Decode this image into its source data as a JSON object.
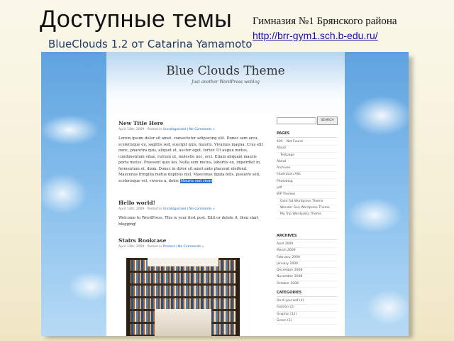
{
  "slide": {
    "title": "Доступные темы",
    "subtitle": "BlueClouds 1.2 от Catarina Yamamoto",
    "school": "Гимназия №1 Брянского района",
    "url": "http://brr-gym1.sch.b-edu.ru/"
  },
  "blog": {
    "title": "Blue Clouds Theme",
    "tagline": "Just another WordPress weblog"
  },
  "posts": [
    {
      "title": "New Title Here",
      "date": "April 13th, 2009",
      "posted_in": "· Posted in",
      "category": "Uncategorized",
      "comments": "| No Comments »",
      "body": "Lorem ipsum dolor sit amet, consectetur adipiscing elit. Donec sem arcu, scelerisque eu, sagittis sed, suscipit quis, mauris. Vivamus magna. Cras elit nunc, pharetra quis, aliquet et, auctor eget, tortor. Ut augue metus, condimentum vitae, rutrum ut, molestie nec, orci. Etiam aliquam mauris porta metus. Praesent quis leo. Nulla sem metus, lobortis eu, imperdiet in, fermentum et, diam. Donec in dolor sit amet ante placerat eleifend. Maecenas fringilla metus dapibus nisl. Maecenas ligula felis, posuere sed, scelerisque vel, viverra a, dolor.",
      "highlight": "Mauris sed risus",
      "tail": "."
    },
    {
      "title": "Hello world!",
      "date": "April 13th, 2009",
      "posted_in": "· Posted in",
      "category": "Uncategorized",
      "comments": "| No Comments »",
      "body": "Welcome to WordPress. This is your first post. Edit or delete it, then start blogging!"
    },
    {
      "title": "Stairs Bookcase",
      "date": "April 13th, 2009",
      "posted_in": "· Posted in",
      "category": "Product",
      "comments": "| No Comments »"
    }
  ],
  "sidebar": {
    "search_button": "SEARCH",
    "pages_title": "PAGES",
    "pages": [
      "404 – Not Found",
      "About",
      "Testpage",
      "About",
      "Archives",
      "Illustration Alts",
      "Photoblog",
      "pdf",
      "WP Themes",
      "Gold Fat Wordpress Theme",
      "Wonder Gen Wordpress Theme",
      "My Trip Wordpress Theme"
    ],
    "pages_sub": [
      false,
      false,
      true,
      false,
      false,
      false,
      false,
      false,
      false,
      true,
      true,
      true
    ],
    "archives_title": "ARCHIVES",
    "archives": [
      "April 2009",
      "March 2009",
      "February 2009",
      "January 2009",
      "December 2008",
      "November 2008",
      "October 2008"
    ],
    "categories_title": "CATEGORIES",
    "categories": [
      "Do-it-yourself (4)",
      "Fashion (2)",
      "Graphic (11)",
      "Green (2)"
    ]
  },
  "colors": {
    "sky_top": "#5ea3df",
    "link": "#1a0dab",
    "highlight": "#2c6fd0"
  }
}
